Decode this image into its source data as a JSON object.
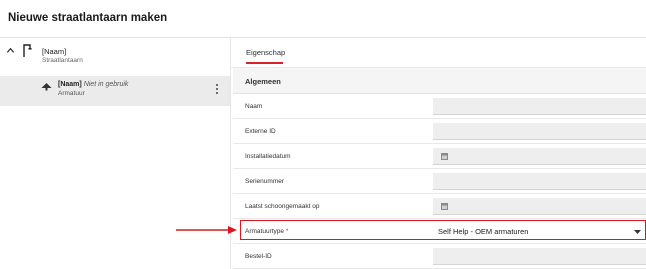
{
  "header": {
    "title": "Nieuwe straatlantaarn maken"
  },
  "tree": {
    "root": {
      "name": "[Naam]",
      "type": "Straatlantaarn",
      "chevron_icon": "chevron-up-icon",
      "icon": "streetlight-icon"
    },
    "child": {
      "name": "[Naam]",
      "status": "Niet in gebruik",
      "type": "Armatuur",
      "icon": "light-fixture-icon",
      "menu_icon": "more-vertical-icon"
    }
  },
  "tabs": [
    {
      "label": "Eigenschap",
      "active": true
    }
  ],
  "section": {
    "title": "Algemeen"
  },
  "fields": [
    {
      "label": "Naam",
      "value": "",
      "required": false,
      "kind": "text"
    },
    {
      "label": "Externe ID",
      "value": "",
      "required": false,
      "kind": "text"
    },
    {
      "label": "Installatiedatum",
      "value": "",
      "required": false,
      "kind": "date",
      "icon": "calendar-icon"
    },
    {
      "label": "Serienummer",
      "value": "",
      "required": false,
      "kind": "text"
    },
    {
      "label": "Laatst schoongemaakt op",
      "value": "",
      "required": false,
      "kind": "date",
      "icon": "calendar-icon"
    },
    {
      "label": "Armatuurtype",
      "required_mark": "*",
      "value": "Self Help - OEM armaturen",
      "required": true,
      "kind": "select",
      "icon": "caret-down-icon"
    },
    {
      "label": "Bestel-ID",
      "value": "",
      "required": false,
      "kind": "text"
    }
  ],
  "annotation": {
    "color": "#d9181f",
    "arrow_icon": "right-arrow-icon"
  },
  "colors": {
    "accent": "#d8232a",
    "field_bg": "#eeeeee",
    "selected_row": "#ebebeb"
  }
}
